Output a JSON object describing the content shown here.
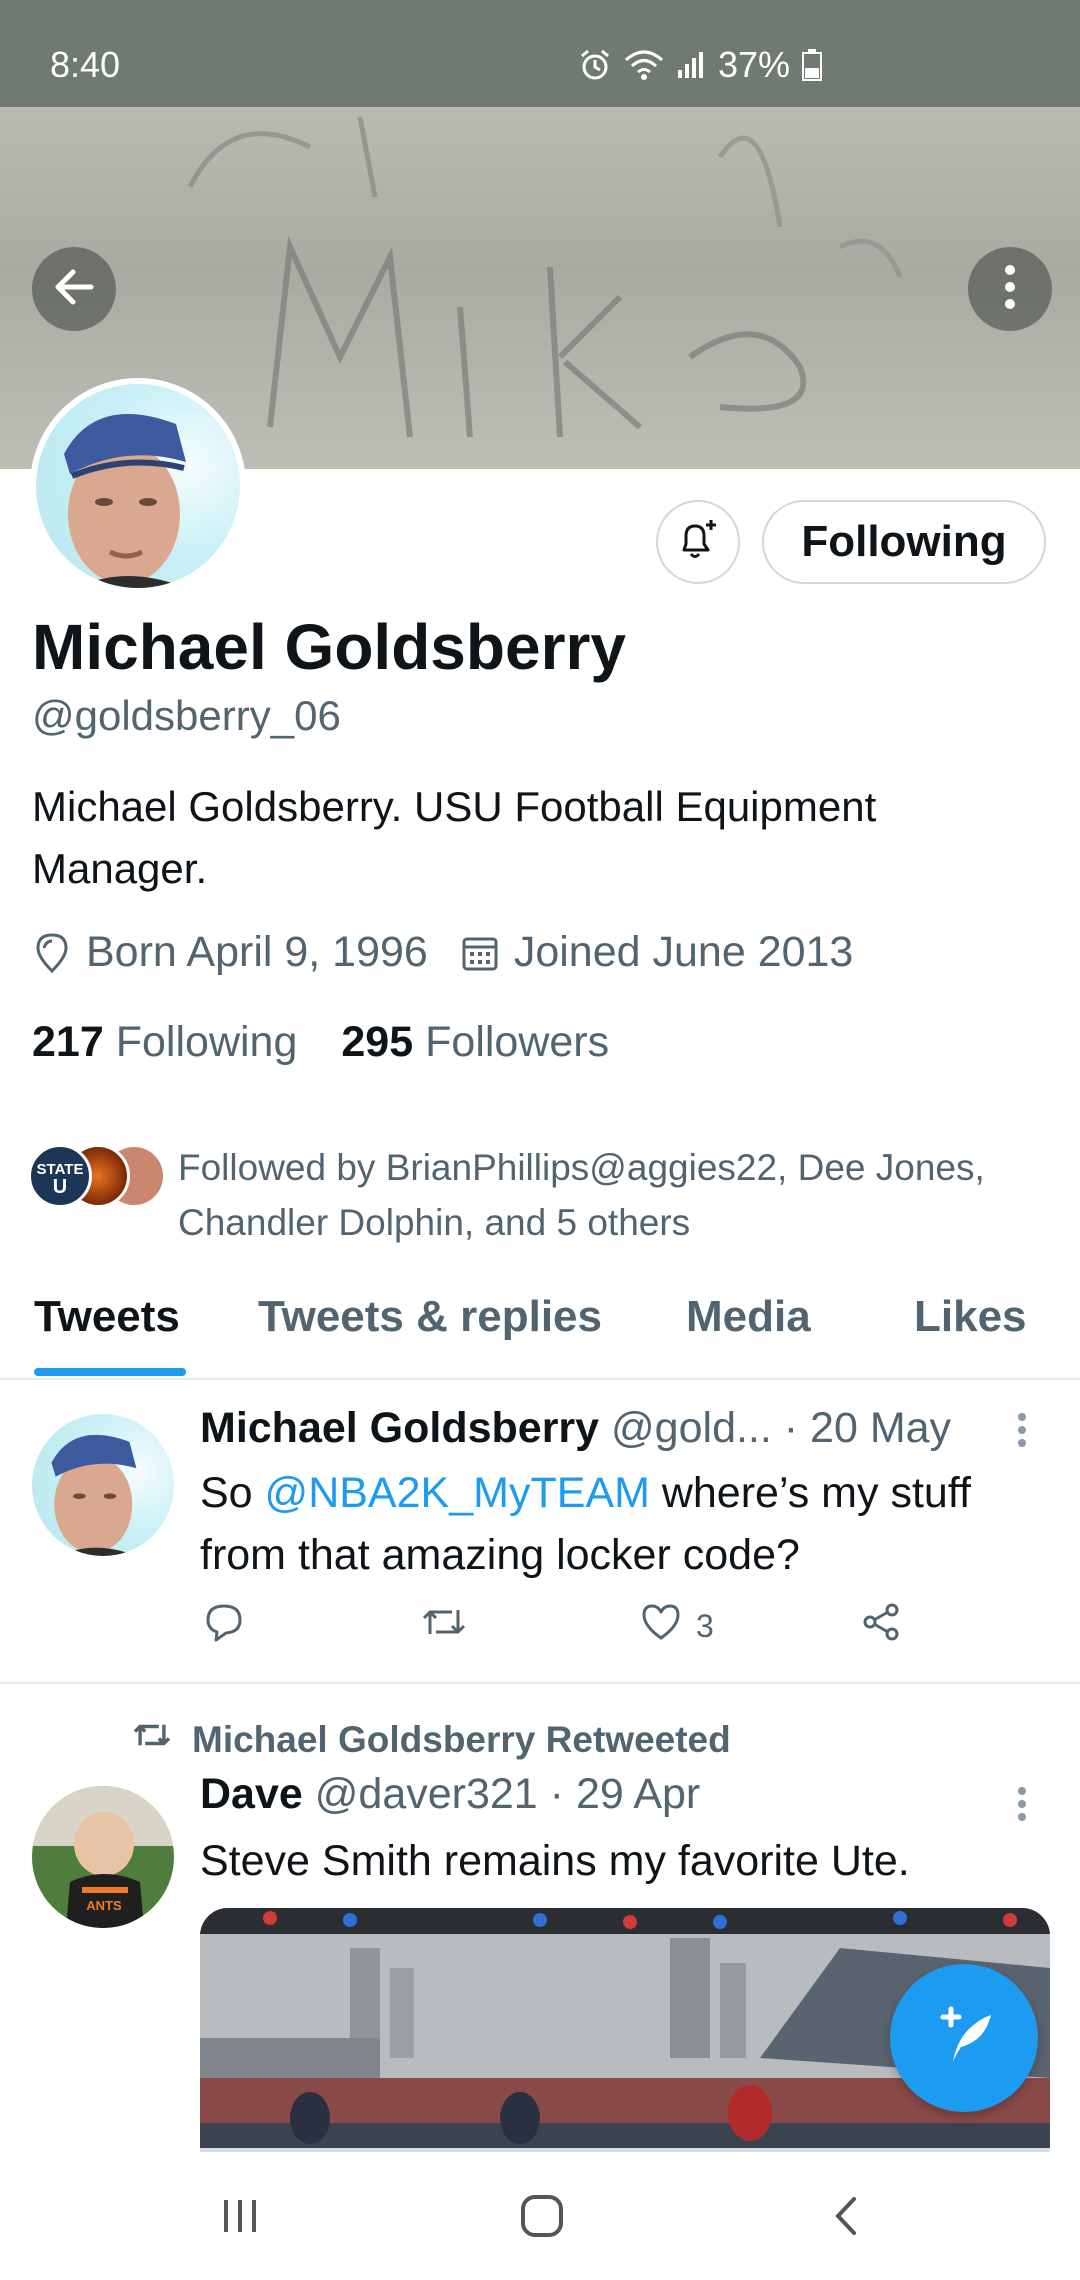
{
  "status_bar": {
    "time": "8:40",
    "battery": "37%"
  },
  "profile": {
    "name": "Michael Goldsberry",
    "handle": "@goldsberry_06",
    "bio": "Michael Goldsberry. USU Football Equipment Manager.",
    "born": "Born April 9, 1996",
    "joined": "Joined June 2013",
    "following_count": "217",
    "following_label": "Following",
    "followers_count": "295",
    "followers_label": "Followers",
    "followed_by": "Followed by BrianPhillips@aggies22, Dee Jones, Chandler Dolphin, and 5 others",
    "follow_button_label": "Following"
  },
  "tabs": [
    {
      "label": "Tweets",
      "active": true
    },
    {
      "label": "Tweets & replies",
      "active": false
    },
    {
      "label": "Media",
      "active": false
    },
    {
      "label": "Likes",
      "active": false
    }
  ],
  "tweets": [
    {
      "name": "Michael Goldsberry",
      "handle": "@gold...",
      "date": "· 20 May",
      "text_pre": "So ",
      "mention": "@NBA2K_MyTEAM",
      "text_post": " where’s my stuff from that amazing locker code?",
      "likes": "3"
    },
    {
      "retweet_label": "Michael Goldsberry Retweeted",
      "name": "Dave",
      "handle": "@daver321",
      "date": "· 29 Apr",
      "text": "Steve Smith remains my favorite Ute."
    }
  ],
  "icons": {
    "back": "arrow-left-icon",
    "more": "more-vertical-icon",
    "bell": "bell-plus-icon",
    "location": "location-icon",
    "calendar": "calendar-icon",
    "reply": "reply-icon",
    "retweet": "retweet-icon",
    "like": "heart-icon",
    "share": "share-icon",
    "compose": "compose-tweet-icon"
  },
  "colors": {
    "accent": "#1d9bf0",
    "secondary_text": "#536471",
    "status_bar": "#6f7a70"
  }
}
